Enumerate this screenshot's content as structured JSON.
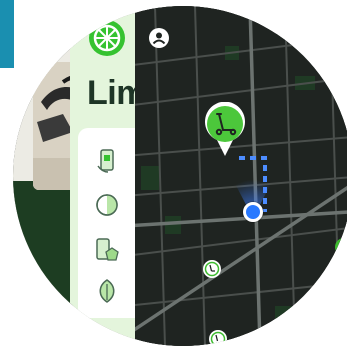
{
  "app": {
    "brand_title": "Lim"
  },
  "icons": {
    "logo": "lime-logo-icon",
    "user": "user-icon",
    "scooter": "scooter-icon",
    "features": [
      "phone-scan-icon",
      "timer-icon",
      "phone-tap-icon",
      "leaf-icon"
    ],
    "poi": "scooter-icon"
  },
  "colors": {
    "brand_green": "#35c230",
    "map_background": "#1f2421",
    "location_blue": "#2979ff",
    "accent_blue": "#1a8fb0"
  }
}
